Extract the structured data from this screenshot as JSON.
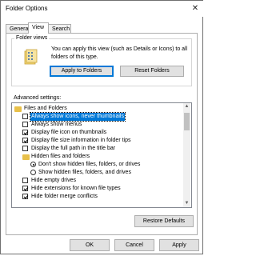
{
  "window": {
    "title": "Folder Options",
    "close_glyph": "✕"
  },
  "tabs": [
    {
      "label": "General"
    },
    {
      "label": "View"
    },
    {
      "label": "Search"
    }
  ],
  "folder_views": {
    "group_label": "Folder views",
    "description": "You can apply this view (such as Details or Icons) to all folders of this type.",
    "apply_button": "Apply to Folders",
    "reset_button": "Reset Folders",
    "icon": "folder-views-icon"
  },
  "advanced": {
    "label": "Advanced settings:",
    "items": [
      {
        "kind": "folder",
        "label": "Files and Folders",
        "indent": 0
      },
      {
        "kind": "check",
        "label": "Always show icons, never thumbnails",
        "checked": false,
        "selected": true,
        "indent": 1
      },
      {
        "kind": "check",
        "label": "Always show menus",
        "checked": false,
        "indent": 1
      },
      {
        "kind": "check",
        "label": "Display file icon on thumbnails",
        "checked": true,
        "indent": 1
      },
      {
        "kind": "check",
        "label": "Display file size information in folder tips",
        "checked": true,
        "indent": 1
      },
      {
        "kind": "check",
        "label": "Display the full path in the title bar",
        "checked": false,
        "indent": 1
      },
      {
        "kind": "folder",
        "label": "Hidden files and folders",
        "indent": 1
      },
      {
        "kind": "radio",
        "label": "Don't show hidden files, folders, or drives",
        "checked": true,
        "indent": 2
      },
      {
        "kind": "radio",
        "label": "Show hidden files, folders, and drives",
        "checked": false,
        "indent": 2
      },
      {
        "kind": "check",
        "label": "Hide empty drives",
        "checked": false,
        "indent": 1
      },
      {
        "kind": "check",
        "label": "Hide extensions for known file types",
        "checked": true,
        "indent": 1
      },
      {
        "kind": "check",
        "label": "Hide folder merge conflicts",
        "checked": true,
        "indent": 1
      }
    ]
  },
  "restore_button": "Restore Defaults",
  "footer": {
    "ok": "OK",
    "cancel": "Cancel",
    "apply": "Apply"
  },
  "colors": {
    "selection": "#0078d7",
    "folder_icon": "#e8c04a"
  }
}
